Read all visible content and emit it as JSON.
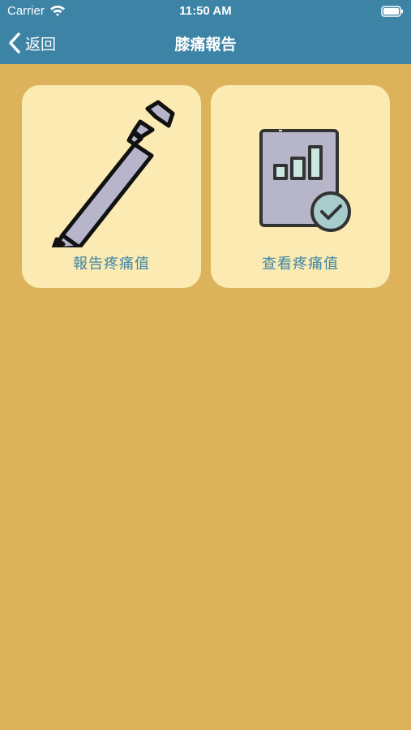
{
  "status_bar": {
    "carrier": "Carrier",
    "time": "11:50 AM"
  },
  "nav": {
    "back_label": "返回",
    "title": "膝痛報告"
  },
  "tiles": [
    {
      "label": "報告疼痛值",
      "icon": "pencil-icon"
    },
    {
      "label": "查看疼痛值",
      "icon": "report-chart-check-icon"
    }
  ],
  "colors": {
    "header": "#3C83A5",
    "background": "#DCB35B",
    "tile": "#FBEAB1",
    "tile_label": "#3D86A8",
    "icon_fill": "#B7B5C9",
    "check_fill": "#A8CCCB",
    "bar_fill": "#C8E8E0"
  }
}
